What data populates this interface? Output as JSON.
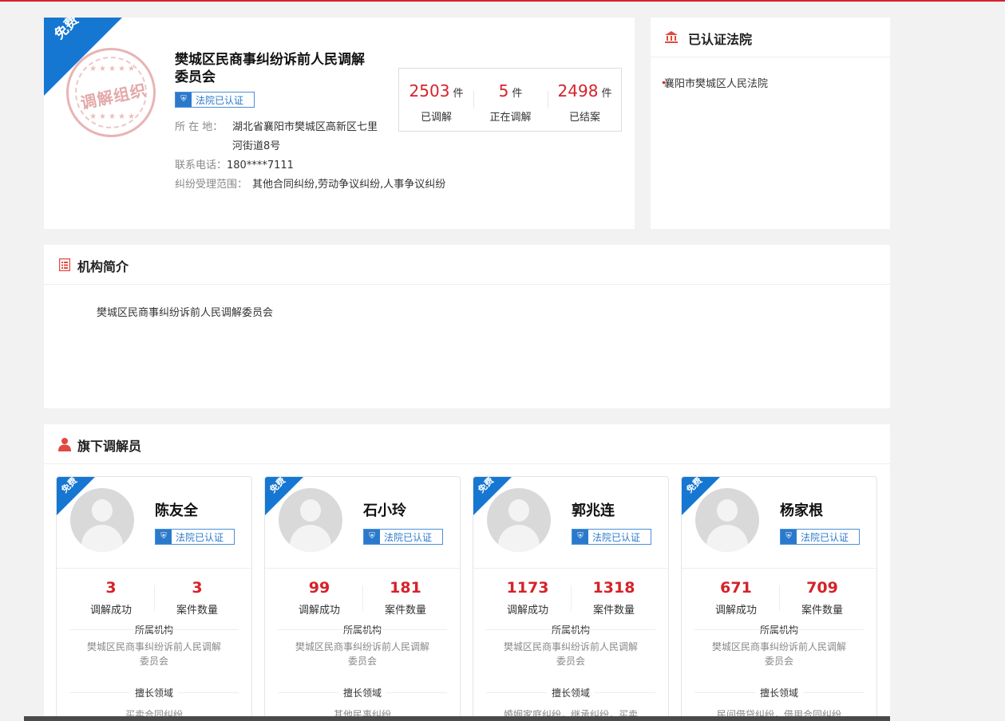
{
  "colors": {
    "accent": "#d6222a",
    "ribbon": "#1677d2",
    "badge": "#2b79cc"
  },
  "org": {
    "free_tag": "免费",
    "seal_text": "调解组织",
    "name": "樊城区民商事纠纷诉前人民调解委员会",
    "badge": "法院已认证",
    "location_label": "所 在 地：",
    "location_line1": "湖北省襄阳市樊城区高新区七里",
    "location_line2": "河街道8号",
    "phone_label": "联系电话：",
    "phone": "180****7111",
    "scope_label": "纠纷受理范围：",
    "scope": "其他合同纠纷,劳动争议纠纷,人事争议纠纷",
    "stats": [
      {
        "num": "2503",
        "unit": "件",
        "label": "已调解"
      },
      {
        "num": "5",
        "unit": "件",
        "label": "正在调解"
      },
      {
        "num": "2498",
        "unit": "件",
        "label": "已结案"
      }
    ]
  },
  "court": {
    "title": "已认证法院",
    "items": [
      "襄阳市樊城区人民法院"
    ]
  },
  "intro": {
    "title": "机构简介",
    "text": "樊城区民商事纠纷诉前人民调解委员会"
  },
  "staff": {
    "title": "旗下调解员",
    "labels": {
      "success": "调解成功",
      "cases": "案件数量",
      "org": "所属机构",
      "field": "擅长领域"
    },
    "mediators": [
      {
        "free": "免费",
        "name": "陈友全",
        "badge": "法院已认证",
        "success": "3",
        "cases": "3",
        "org_line1": "樊城区民商事纠纷诉前人民调解",
        "org_line2": "委员会",
        "field": "买卖合同纠纷"
      },
      {
        "free": "免费",
        "name": "石小玲",
        "badge": "法院已认证",
        "success": "99",
        "cases": "181",
        "org_line1": "樊城区民商事纠纷诉前人民调解",
        "org_line2": "委员会",
        "field": "其他民事纠纷"
      },
      {
        "free": "免费",
        "name": "郭兆连",
        "badge": "法院已认证",
        "success": "1173",
        "cases": "1318",
        "org_line1": "樊城区民商事纠纷诉前人民调解",
        "org_line2": "委员会",
        "field": "婚姻家庭纠纷，继承纠纷，买卖"
      },
      {
        "free": "免费",
        "name": "杨家根",
        "badge": "法院已认证",
        "success": "671",
        "cases": "709",
        "org_line1": "樊城区民商事纠纷诉前人民调解",
        "org_line2": "委员会",
        "field": "民间借贷纠纷，借用合同纠纷"
      }
    ]
  }
}
